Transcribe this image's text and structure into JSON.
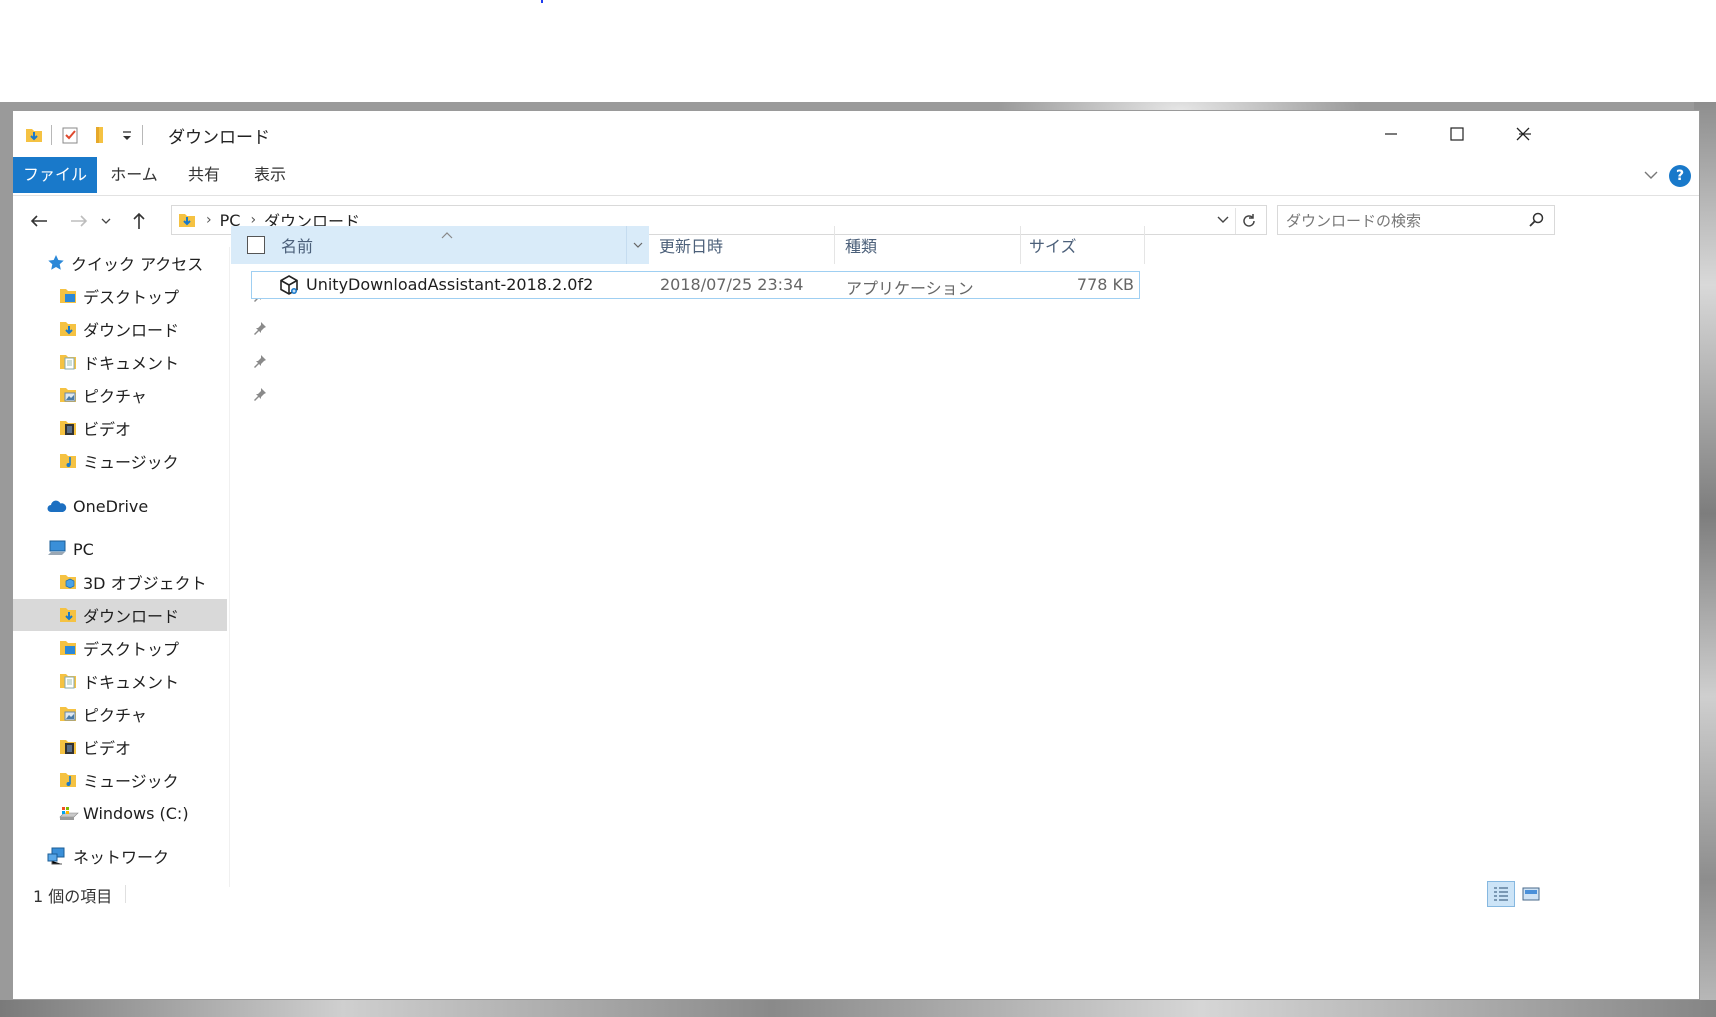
{
  "window": {
    "title": "ダウンロード",
    "minimize_symbol": "—",
    "maximize_symbol": "☐",
    "close_symbol": "✕"
  },
  "ribbon": {
    "tabs": [
      {
        "label": "ファイル",
        "active": true
      },
      {
        "label": "ホーム"
      },
      {
        "label": "共有"
      },
      {
        "label": "表示"
      }
    ],
    "help_label": "?"
  },
  "address": {
    "crumbs": [
      "PC",
      "ダウンロード"
    ]
  },
  "search": {
    "placeholder": "ダウンロードの検索"
  },
  "nav": {
    "quick_access": {
      "label": "クイック アクセス",
      "items": [
        {
          "label": "デスクトップ",
          "icon": "desktop-folder-icon",
          "pinned": true
        },
        {
          "label": "ダウンロード",
          "icon": "downloads-folder-icon",
          "pinned": true
        },
        {
          "label": "ドキュメント",
          "icon": "documents-folder-icon",
          "pinned": true
        },
        {
          "label": "ピクチャ",
          "icon": "pictures-folder-icon",
          "pinned": true
        },
        {
          "label": "ビデオ",
          "icon": "videos-folder-icon",
          "pinned": false
        },
        {
          "label": "ミュージック",
          "icon": "music-folder-icon",
          "pinned": false
        }
      ]
    },
    "onedrive": {
      "label": "OneDrive"
    },
    "pc": {
      "label": "PC",
      "items": [
        {
          "label": "3D オブジェクト",
          "icon": "3d-objects-folder-icon"
        },
        {
          "label": "ダウンロード",
          "icon": "downloads-folder-icon",
          "selected": true
        },
        {
          "label": "デスクトップ",
          "icon": "desktop-folder-icon"
        },
        {
          "label": "ドキュメント",
          "icon": "documents-folder-icon"
        },
        {
          "label": "ピクチャ",
          "icon": "pictures-folder-icon"
        },
        {
          "label": "ビデオ",
          "icon": "videos-folder-icon"
        },
        {
          "label": "ミュージック",
          "icon": "music-folder-icon"
        },
        {
          "label": "Windows (C:)",
          "icon": "drive-icon"
        }
      ]
    },
    "network": {
      "label": "ネットワーク"
    }
  },
  "columns": {
    "name": "名前",
    "modified": "更新日時",
    "type": "種類",
    "size": "サイズ"
  },
  "files": [
    {
      "name": "UnityDownloadAssistant-2018.2.0f2",
      "modified": "2018/07/25 23:34",
      "type": "アプリケーション",
      "size": "778 KB",
      "icon": "unity-icon"
    }
  ],
  "status": {
    "item_count": "1 個の項目"
  },
  "colors": {
    "accent": "#1979ca",
    "selection": "#d9ebf9",
    "header_text": "#4c607a"
  }
}
